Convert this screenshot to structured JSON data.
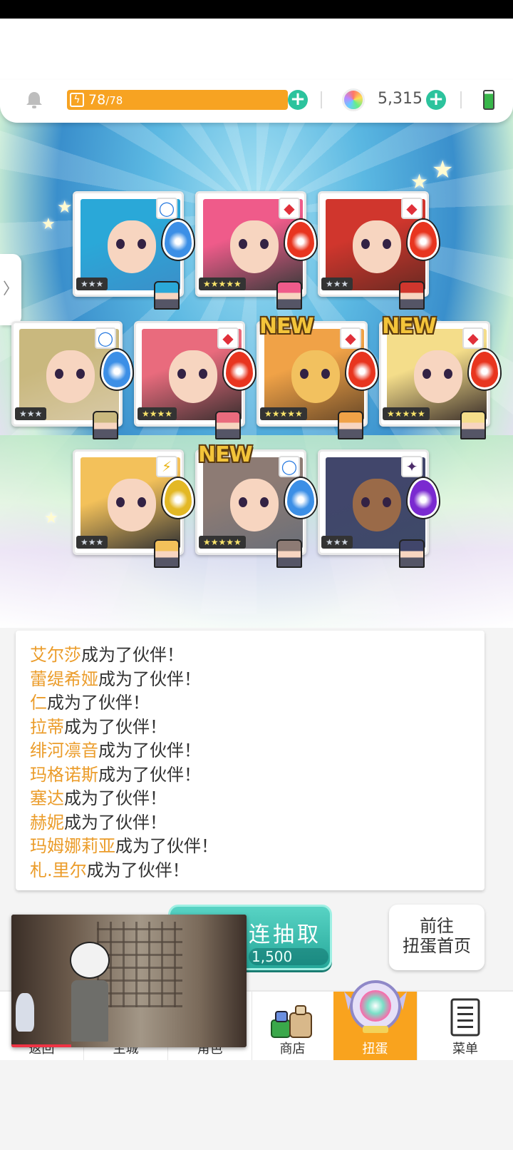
{
  "hud": {
    "energy_current": "78",
    "energy_max": "/78",
    "energy_fraction": 1.0,
    "gem_count": "5,315",
    "icons": [
      "bell-icon",
      "energy-icon",
      "plus-icon",
      "gem-icon",
      "battery-icon"
    ]
  },
  "side_tab": {
    "label": "〉"
  },
  "cards": [
    {
      "stars": "★★★",
      "badge": "◯",
      "attribute": "water",
      "new": ""
    },
    {
      "stars": "★★★★★",
      "badge": "◆",
      "attribute": "fire",
      "new": ""
    },
    {
      "stars": "★★★",
      "badge": "◆",
      "attribute": "fire",
      "new": ""
    },
    {
      "stars": "★★★",
      "badge": "◯",
      "attribute": "water",
      "new": ""
    },
    {
      "stars": "★★★★",
      "badge": "◆",
      "attribute": "fire",
      "new": ""
    },
    {
      "stars": "★★★★★",
      "badge": "◆",
      "attribute": "fire",
      "new": "NEW"
    },
    {
      "stars": "★★★★★",
      "badge": "◆",
      "attribute": "fire",
      "new": "NEW"
    },
    {
      "stars": "★★★",
      "badge": "⚡",
      "attribute": "thunder",
      "new": ""
    },
    {
      "stars": "★★★★★",
      "badge": "◯",
      "attribute": "water",
      "new": "NEW"
    },
    {
      "stars": "★★★",
      "badge": "✦",
      "attribute": "dark",
      "new": ""
    }
  ],
  "messages": [
    {
      "name": "艾尔莎",
      "suffix": "成为了伙伴！"
    },
    {
      "name": "蕾缇希娅",
      "suffix": "成为了伙伴！"
    },
    {
      "name": "仁",
      "suffix": "成为了伙伴！"
    },
    {
      "name": "拉蒂",
      "suffix": "成为了伙伴！"
    },
    {
      "name": "绯河凛音",
      "suffix": "成为了伙伴！"
    },
    {
      "name": "玛格诺斯",
      "suffix": "成为了伙伴！"
    },
    {
      "name": "塞达",
      "suffix": "成为了伙伴！"
    },
    {
      "name": "赫妮",
      "suffix": "成为了伙伴！"
    },
    {
      "name": "玛姆娜莉亚",
      "suffix": "成为了伙伴！"
    },
    {
      "name": "札.里尔",
      "suffix": "成为了伙伴！"
    }
  ],
  "pull_button": {
    "label": "连抽取",
    "cost": "1,500"
  },
  "gacha_home": {
    "line1": "前往",
    "line2": "扭蛋首页"
  },
  "nav": [
    {
      "label": "返回",
      "icon": "back-icon"
    },
    {
      "label": "主城",
      "icon": "castle-icon"
    },
    {
      "label": "角色",
      "icon": "character-icon"
    },
    {
      "label": "商店",
      "icon": "shop-icon"
    },
    {
      "label": "扭蛋",
      "icon": "gacha-icon",
      "active": true
    },
    {
      "label": "菜单",
      "icon": "menu-icon"
    }
  ],
  "colors": {
    "energy": "#f7a322",
    "accent_teal": "#2cc39d",
    "name_orange": "#eb9c2a",
    "active_tab": "#f9a31e"
  }
}
